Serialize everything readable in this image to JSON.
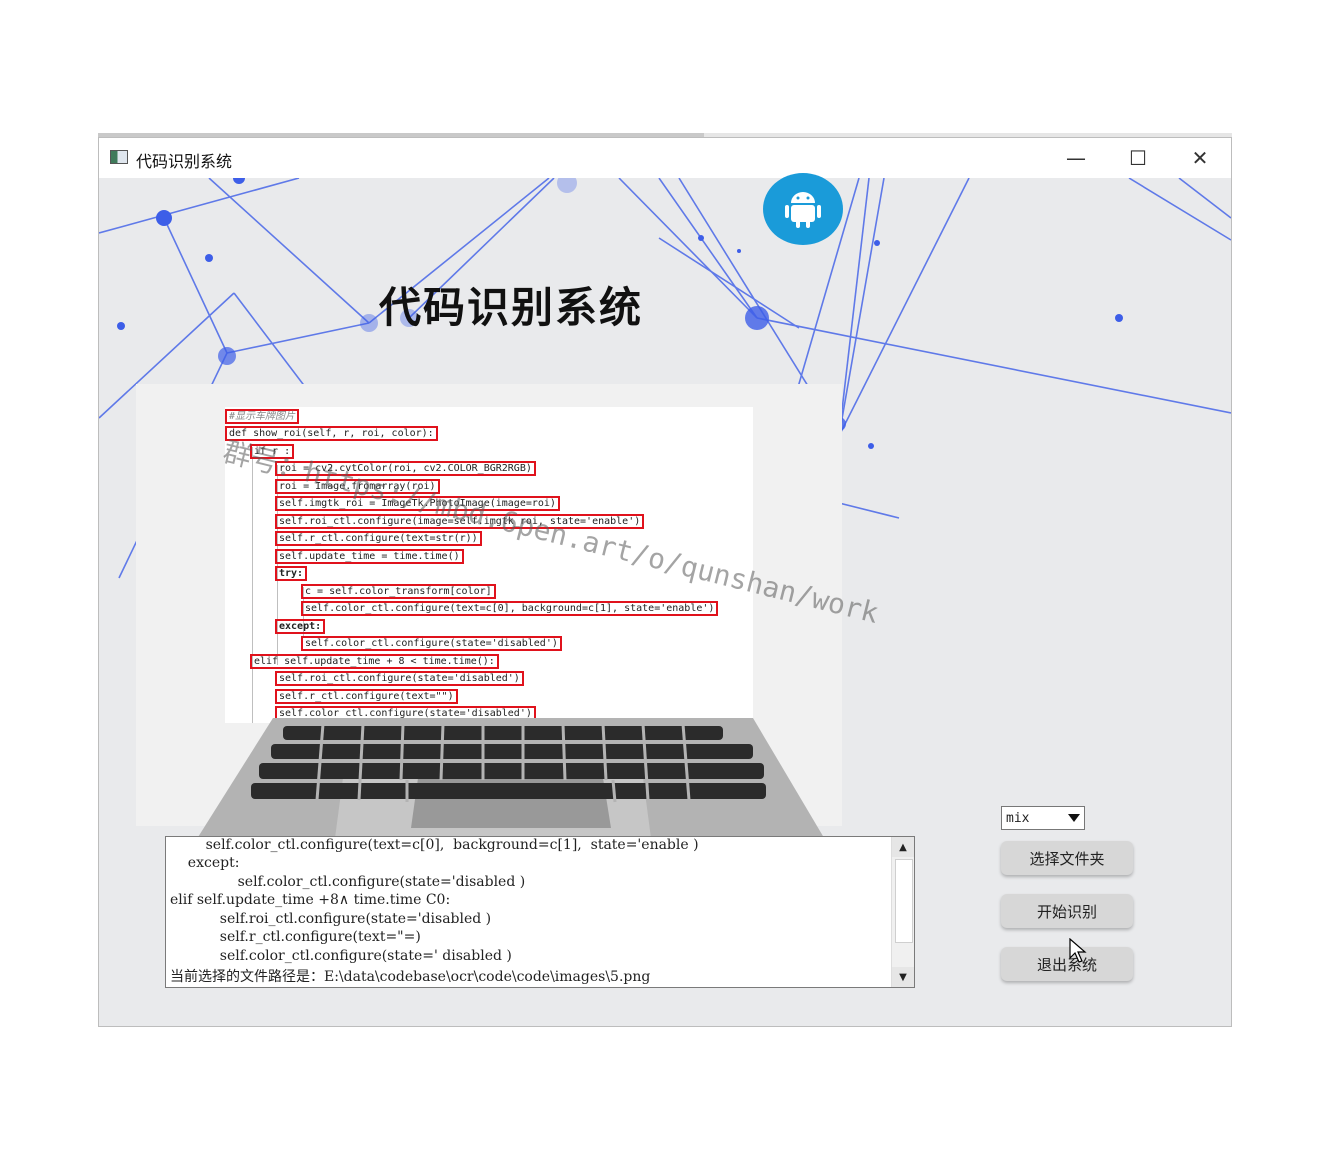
{
  "window": {
    "title": "代码识别系统",
    "controls": {
      "minimize": "—",
      "maximize": "☐",
      "close": "✕"
    }
  },
  "header": {
    "title": "代码识别系统",
    "badge_icon": "android-icon"
  },
  "code_preview": {
    "lines": [
      "#显示车牌图片",
      "def show_roi(self, r, roi, color):",
      "if r :",
      "roi = cv2.cvtColor(roi, cv2.COLOR_BGR2RGB)",
      "roi = Image.fromarray(roi)",
      "self.imgtk_roi = ImageTk.PhotoImage(image=roi)",
      "self.roi_ctl.configure(image=self.imgtk_roi, state='enable')",
      "self.r_ctl.configure(text=str(r))",
      "self.update_time = time.time()",
      "try:",
      "c = self.color_transform[color]",
      "self.color_ctl.configure(text=c[0], background=c[1], state='enable')",
      "except:",
      "self.color_ctl.configure(state='disabled')",
      "elif self.update_time + 8 < time.time():",
      "self.roi_ctl.configure(state='disabled')",
      "self.r_ctl.configure(text=\"\")",
      "self.color_ctl.configure(state='disabled')"
    ]
  },
  "watermark": "群号：https://mbd.6pen.art/o/qunshan/work",
  "output": {
    "lines": [
      "        self.color_ctl.configure(text=c[0],  background=c[1],  state='enable )",
      "    except:",
      "        self.color_ctl.configure(state='disabled )",
      "elif self.update_time +8∧ time.time C0:",
      "    self.roi_ctl.configure(state='disabled )",
      "    self.r_ctl.configure(text=\"=)",
      "    self.color_ctl.configure(state=' disabled )",
      "当前选择的文件路径是：E:\\data\\codebase\\ocr\\code\\code\\images\\5.png"
    ],
    "scroll_up": "▲",
    "scroll_down": "▼"
  },
  "controls": {
    "mode_select": "mix",
    "btn_choose_folder": "选择文件夹",
    "btn_start": "开始识别",
    "btn_exit": "退出系统"
  },
  "colors": {
    "accent": "#1a9bd9",
    "network_lines": "#3d5ee8",
    "code_box": "#e0121c"
  }
}
